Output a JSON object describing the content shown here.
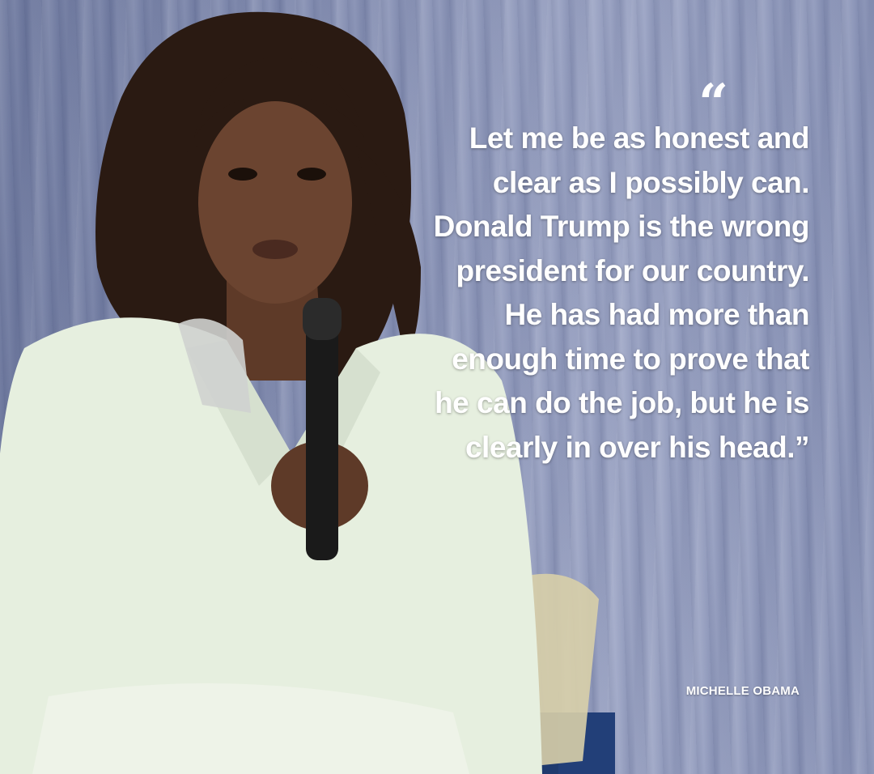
{
  "quote": {
    "open_mark": "“",
    "text": "Let me be as honest and clear as I possibly can. Donald Trump is the wrong president for our country. He has had more than enough time to prove that he can do the job, but he is clearly in over his head.”",
    "attribution": "MICHELLE OBAMA"
  },
  "photo": {
    "subject": "speaker-with-microphone",
    "colors": {
      "backdrop": "#8d97b8",
      "suit": "#e6efdf",
      "skin": "#6b4430",
      "hair": "#2a1a12",
      "chair": "#1f3a6e"
    }
  }
}
